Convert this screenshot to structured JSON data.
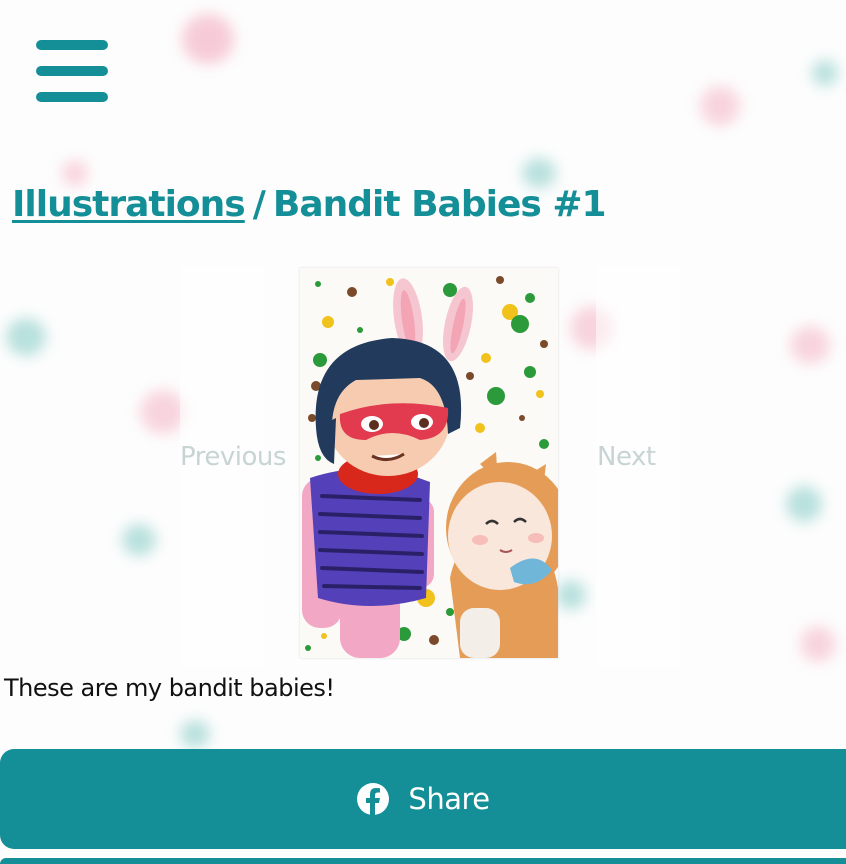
{
  "menu": {
    "icon": "hamburger-menu-icon"
  },
  "breadcrumb": {
    "parent_label": "Illustrations",
    "separator": "/",
    "current_label": "Bandit Babies #1"
  },
  "gallery": {
    "previous_label": "Previous",
    "next_label": "Next",
    "image_alt": "Watercolor illustration of a girl with bunny ears in a red bandit mask next to a baby in a fox hood"
  },
  "post": {
    "caption": "These are my bandit babies!"
  },
  "share": {
    "label": "Share",
    "icon": "facebook-icon"
  },
  "colors": {
    "accent": "#148f98",
    "nav_text": "#c8d4d4",
    "caption_text": "#111111"
  }
}
